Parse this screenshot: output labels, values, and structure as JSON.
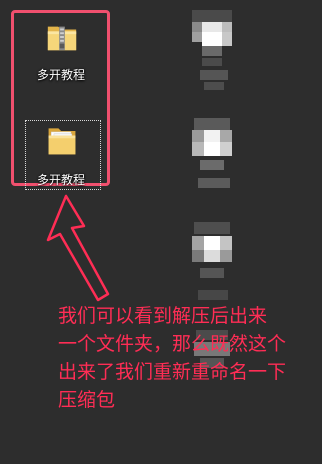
{
  "desktop": {
    "icons": [
      {
        "label": "多开教程",
        "icon": "zip-folder-icon"
      },
      {
        "label": "多开教程",
        "icon": "folder-icon",
        "selected": true
      }
    ]
  },
  "annotation": {
    "color": "#ff2d55",
    "lines": [
      "我们可以看到解压后出来",
      "一个文件夹，那么既然这个",
      "出来了我们重新重命名一下",
      "压缩包"
    ]
  }
}
